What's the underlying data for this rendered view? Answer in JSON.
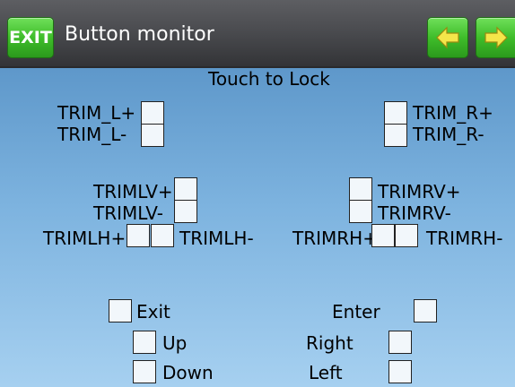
{
  "header": {
    "exit_label": "EXIT",
    "title": "Button monitor",
    "prev_icon": "arrow-left-icon",
    "next_icon": "arrow-right-icon"
  },
  "instruction": "Touch to Lock",
  "trims": {
    "trim_l_plus": "TRIM_L+",
    "trim_l_minus": "TRIM_L-",
    "trim_r_plus": "TRIM_R+",
    "trim_r_minus": "TRIM_R-",
    "trim_lv_plus": "TRIMLV+",
    "trim_lv_minus": "TRIMLV-",
    "trim_lh_plus": "TRIMLH+",
    "trim_lh_minus": "TRIMLH-",
    "trim_rv_plus": "TRIMRV+",
    "trim_rv_minus": "TRIMRV-",
    "trim_rh_plus": "TRIMRH+",
    "trim_rh_minus": "TRIMRH-"
  },
  "buttons": {
    "exit": "Exit",
    "enter": "Enter",
    "up": "Up",
    "right": "Right",
    "down": "Down",
    "left": "Left"
  },
  "colors": {
    "accent_green": "#3fbd2a",
    "titlebar": "#4b4c50",
    "background": "#6ea5d6"
  }
}
